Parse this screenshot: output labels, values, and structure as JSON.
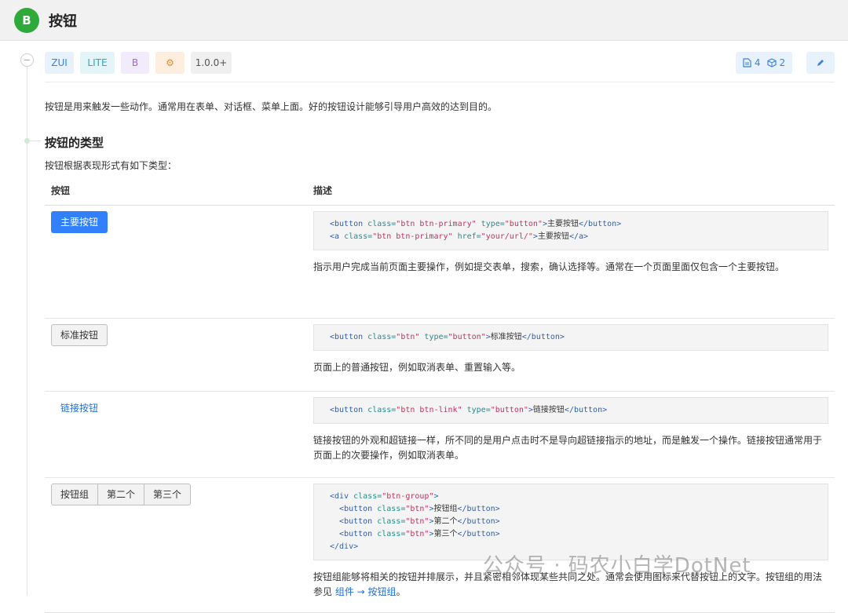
{
  "header": {
    "logo": "B",
    "title": "按钮"
  },
  "tags": [
    "ZUI",
    "LITE",
    "B",
    "⚙",
    "1.0.0+"
  ],
  "stats": {
    "files": "4",
    "packages": "2",
    "file_icon": "file-icon",
    "package_icon": "package-icon"
  },
  "edit_icon": "pencil-icon",
  "intro": "按钮是用来触发一些动作。通常用在表单、对话框、菜单上面。好的按钮设计能够引导用户高效的达到目的。",
  "section": {
    "title": "按钮的类型",
    "subtitle": "按钮根据表现形式有如下类型："
  },
  "table": {
    "headers": [
      "按钮",
      "描述"
    ],
    "rows": [
      {
        "button": "主要按钮",
        "code": [
          "<button class=\"btn btn-primary\" type=\"button\">主要按钮</button>",
          "<a class=\"btn btn-primary\" href=\"your/url/\">主要按钮</a>"
        ],
        "desc": "指示用户完成当前页面主要操作，例如提交表单，搜索，确认选择等。通常在一个页面里面仅包含一个主要按钮。"
      },
      {
        "button": "标准按钮",
        "code": [
          "<button class=\"btn\" type=\"button\">标准按钮</button>"
        ],
        "desc": "页面上的普通按钮，例如取消表单、重置输入等。"
      },
      {
        "button": "链接按钮",
        "code": [
          "<button class=\"btn btn-link\" type=\"button\">链接按钮</button>"
        ],
        "desc": "链接按钮的外观和超链接一样，所不同的是用户点击时不是导向超链接指示的地址，而是触发一个操作。链接按钮通常用于页面上的次要操作，例如取消表单。"
      },
      {
        "buttons": [
          "按钮组",
          "第二个",
          "第三个"
        ],
        "code": [
          "<div class=\"btn-group\">",
          "  <button class=\"btn\">按钮组</button>",
          "  <button class=\"btn\">第二个</button>",
          "  <button class=\"btn\">第三个</button>",
          "</div>"
        ],
        "desc_before": "按钮组能够将相关的按钮并排展示，并且紧密相邻体现某些共同之处。通常会使用图标来代替按钮上的文字。按钮组的用法参见 ",
        "desc_link": "组件 → 按钮组",
        "desc_after": "。"
      }
    ]
  },
  "watermark": "公众号 · 码农小白学DotNet"
}
